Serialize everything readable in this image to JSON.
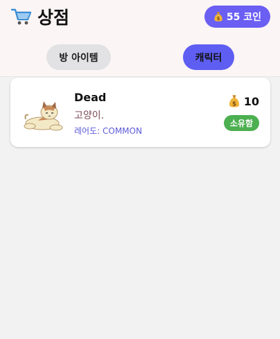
{
  "header": {
    "title": "상점",
    "coins_label": "55 코인",
    "icons": {
      "title": "shopping-cart-icon",
      "coin": "money-bag-icon"
    }
  },
  "tabs": [
    {
      "label": "방 아이템",
      "active": false
    },
    {
      "label": "캐릭터",
      "active": true
    }
  ],
  "items": [
    {
      "name": "Dead",
      "description": "고양이.",
      "rarity_label": "레어도:",
      "rarity_value": "COMMON",
      "price": "10",
      "status": "소유함",
      "image": "cat-lying-icon"
    }
  ],
  "colors": {
    "accent": "#6a5ef3",
    "owned_badge": "#4caf50",
    "background": "#f2f2f2",
    "header_background": "#fcf5f6"
  }
}
